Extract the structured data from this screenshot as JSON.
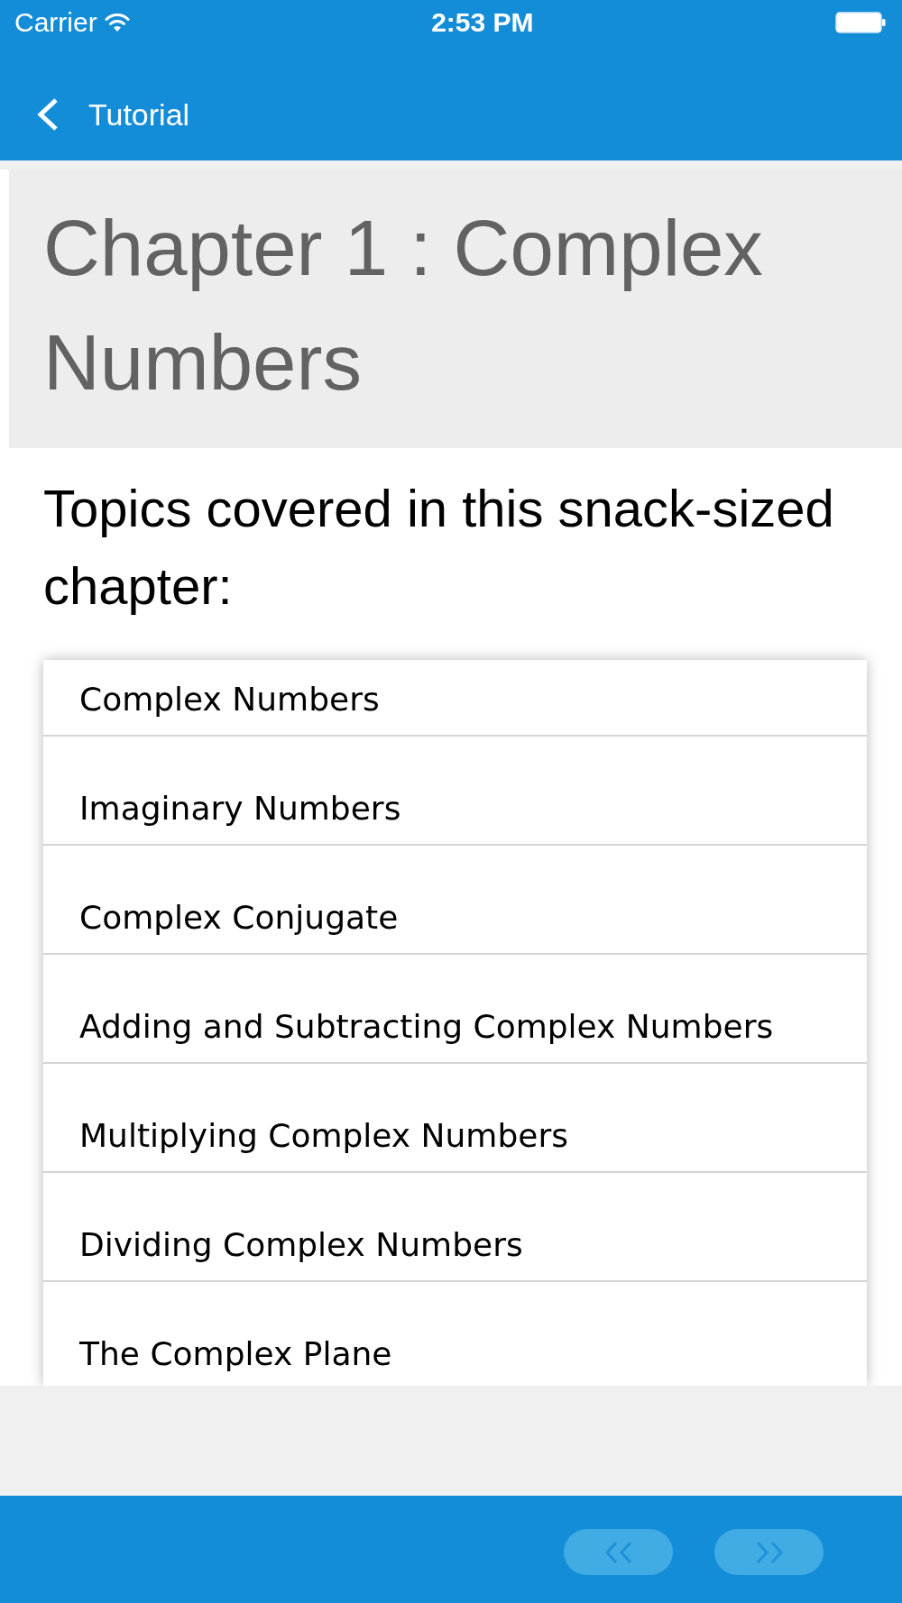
{
  "status_bar": {
    "carrier": "Carrier",
    "time": "2:53 PM"
  },
  "nav_bar": {
    "back_label": "Tutorial"
  },
  "chapter": {
    "title": "Chapter 1 : Complex Numbers",
    "intro": "Topics covered in this snack-sized chapter:"
  },
  "topics": [
    "Complex Numbers",
    "Imaginary Numbers",
    "Complex Conjugate",
    "Adding and Subtracting Complex Numbers",
    "Multiplying Complex Numbers",
    "Dividing Complex Numbers",
    "The Complex Plane"
  ],
  "pager": [
    {
      "kind": "previous"
    },
    {
      "kind": "next"
    }
  ]
}
